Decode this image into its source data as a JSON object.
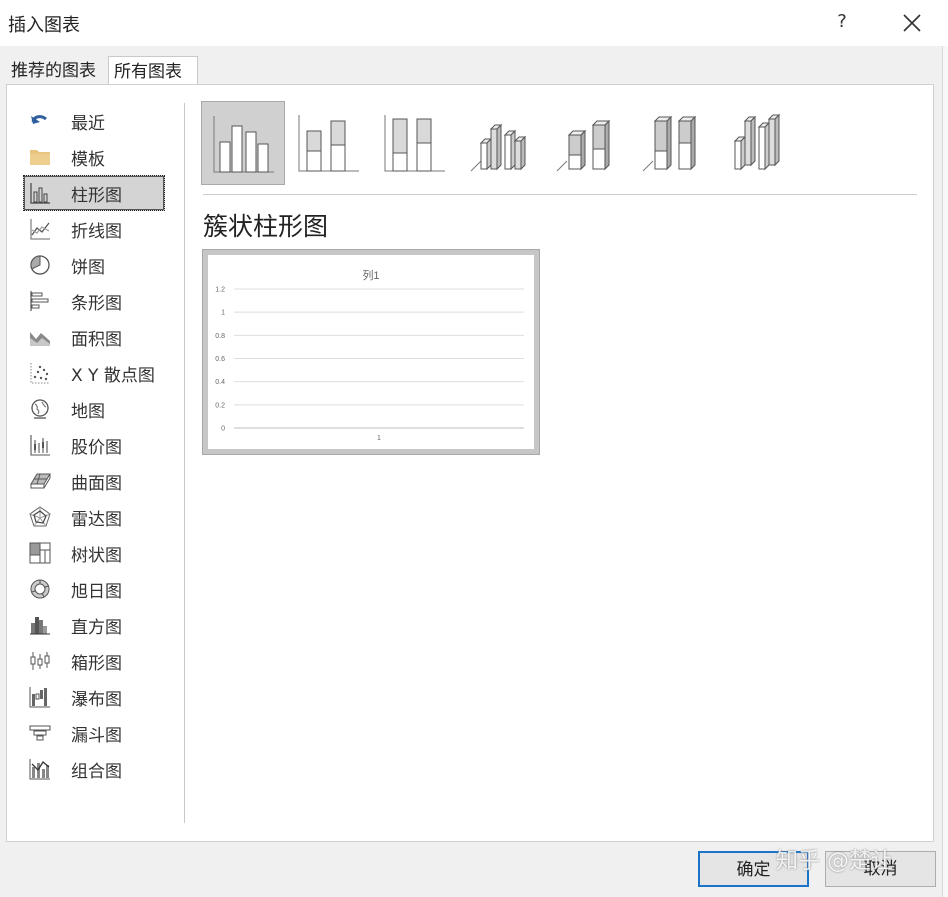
{
  "window": {
    "title": "插入图表",
    "help_label": "?",
    "close_icon": "close-icon"
  },
  "tabs": [
    {
      "label": "推荐的图表",
      "active": false
    },
    {
      "label": "所有图表",
      "active": true
    }
  ],
  "sidebar": {
    "items": [
      {
        "label": "最近",
        "icon": "undo-arrow-icon",
        "selected": false
      },
      {
        "label": "模板",
        "icon": "folder-icon",
        "selected": false
      },
      {
        "label": "柱形图",
        "icon": "column-chart-icon",
        "selected": true
      },
      {
        "label": "折线图",
        "icon": "line-chart-icon",
        "selected": false
      },
      {
        "label": "饼图",
        "icon": "pie-chart-icon",
        "selected": false
      },
      {
        "label": "条形图",
        "icon": "bar-chart-icon",
        "selected": false
      },
      {
        "label": "面积图",
        "icon": "area-chart-icon",
        "selected": false
      },
      {
        "label": "X Y 散点图",
        "icon": "scatter-chart-icon",
        "selected": false
      },
      {
        "label": "地图",
        "icon": "globe-icon",
        "selected": false
      },
      {
        "label": "股价图",
        "icon": "stock-chart-icon",
        "selected": false
      },
      {
        "label": "曲面图",
        "icon": "surface-chart-icon",
        "selected": false
      },
      {
        "label": "雷达图",
        "icon": "radar-chart-icon",
        "selected": false
      },
      {
        "label": "树状图",
        "icon": "treemap-icon",
        "selected": false
      },
      {
        "label": "旭日图",
        "icon": "sunburst-icon",
        "selected": false
      },
      {
        "label": "直方图",
        "icon": "histogram-icon",
        "selected": false
      },
      {
        "label": "箱形图",
        "icon": "box-whisker-icon",
        "selected": false
      },
      {
        "label": "瀑布图",
        "icon": "waterfall-chart-icon",
        "selected": false
      },
      {
        "label": "漏斗图",
        "icon": "funnel-chart-icon",
        "selected": false
      },
      {
        "label": "组合图",
        "icon": "combo-chart-icon",
        "selected": false
      }
    ]
  },
  "subtypes": [
    {
      "name": "clustered-column",
      "selected": true
    },
    {
      "name": "stacked-column",
      "selected": false
    },
    {
      "name": "100-stacked-column",
      "selected": false
    },
    {
      "name": "3d-clustered-column",
      "selected": false
    },
    {
      "name": "3d-stacked-column",
      "selected": false
    },
    {
      "name": "3d-100-stacked-column",
      "selected": false
    },
    {
      "name": "3d-column",
      "selected": false
    }
  ],
  "selected_subtype_title": "簇状柱形图",
  "chart_data": {
    "type": "bar",
    "title": "列1",
    "categories": [
      "1"
    ],
    "series": [
      {
        "values": []
      }
    ],
    "ylim": [
      0,
      1.2
    ],
    "yticks": [
      "1.2",
      "1",
      "0.8",
      "0.6",
      "0.4",
      "0.2",
      "0"
    ],
    "grid": true,
    "legend": "none"
  },
  "buttons": {
    "ok": "确定",
    "cancel": "取消"
  },
  "watermark": "知乎 @楚让",
  "colors": {
    "selection_bg": "#d4d4d4",
    "ok_border": "#1b74c8",
    "folder": "#e8c47f",
    "recent_arrow": "#2f5f9e"
  }
}
